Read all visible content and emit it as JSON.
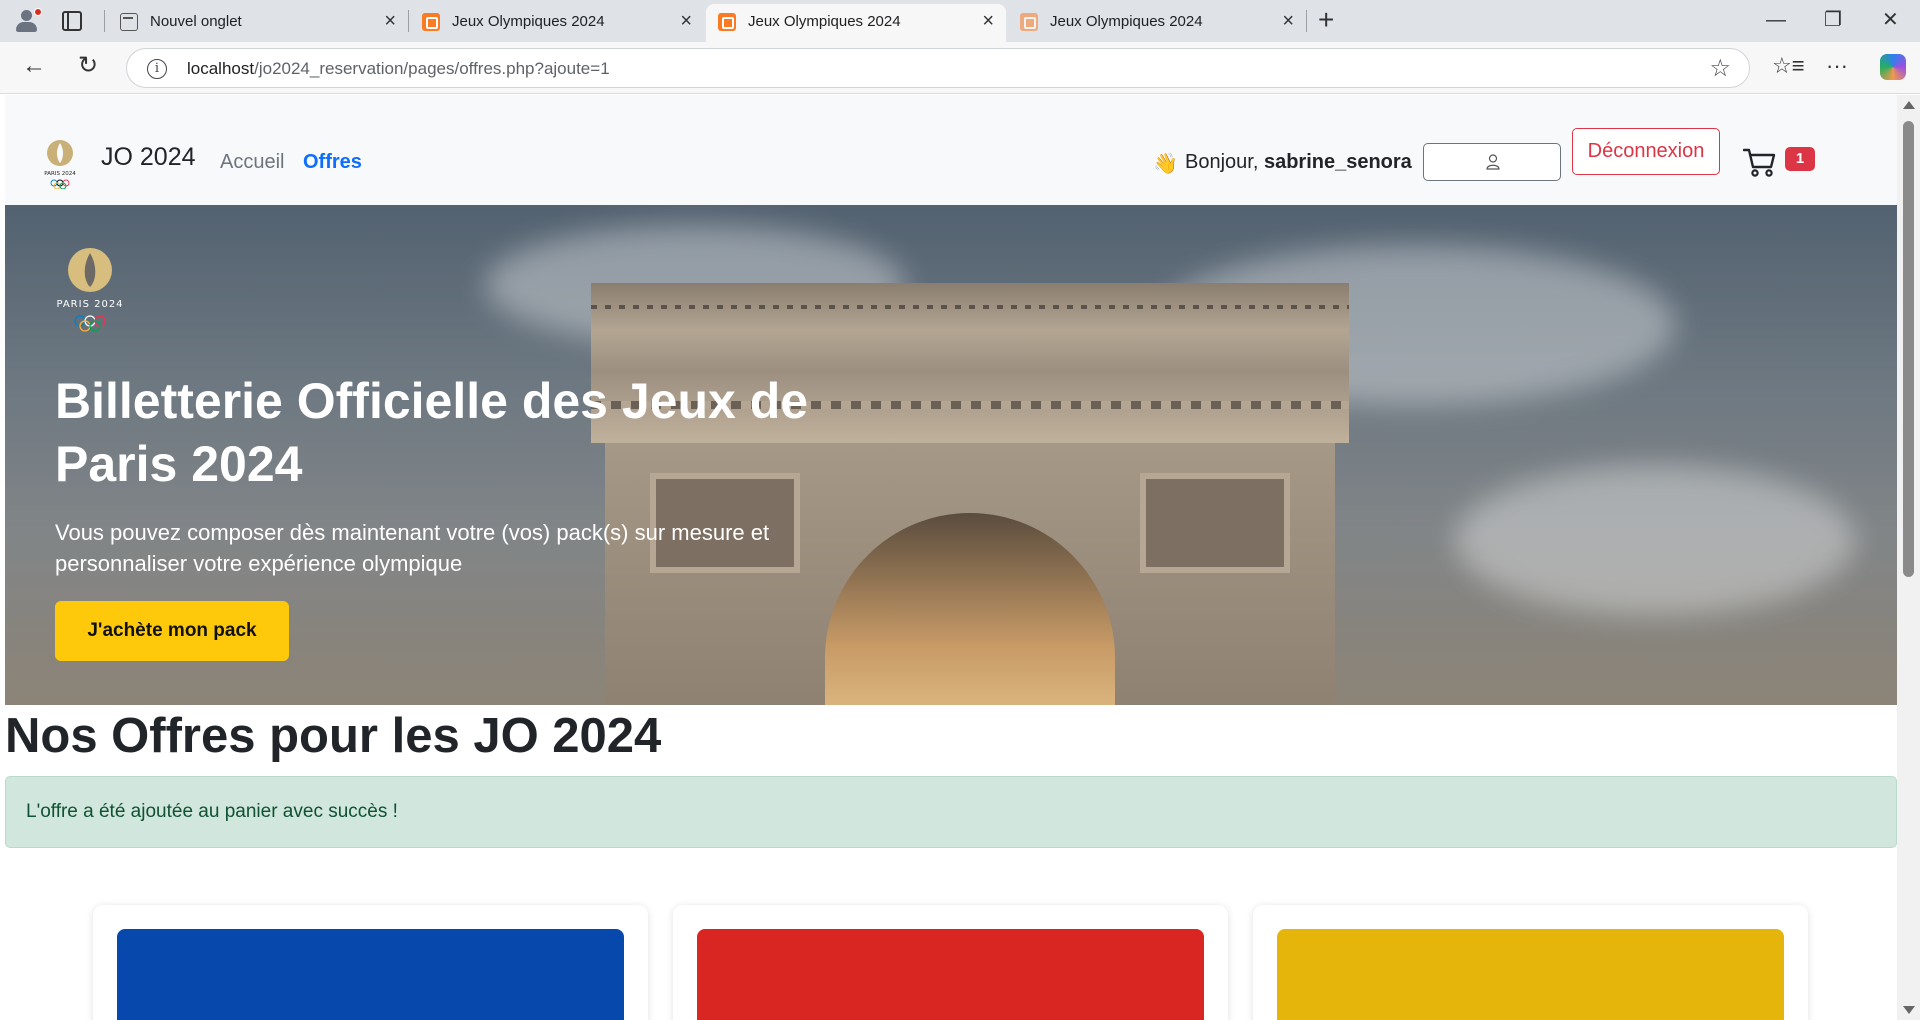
{
  "browser": {
    "tabs": [
      {
        "title": "Nouvel onglet",
        "active": false
      },
      {
        "title": "Jeux Olympiques 2024",
        "active": false
      },
      {
        "title": "Jeux Olympiques 2024",
        "active": true
      },
      {
        "title": "Jeux Olympiques 2024",
        "active": false
      }
    ],
    "url_host": "localhost",
    "url_path": "/jo2024_reservation/pages/offres.php?ajoute=1",
    "icons": {
      "close": "×",
      "new_tab": "+",
      "minimize": "—",
      "restore": "❐",
      "window_close": "✕",
      "back": "←",
      "reload": "↻",
      "info": "i",
      "favorite": "☆",
      "favorites": "☆≡",
      "more": "···"
    }
  },
  "navbar": {
    "brand": "JO 2024",
    "links": [
      {
        "label": "Accueil",
        "active": false
      },
      {
        "label": "Offres",
        "active": true
      }
    ],
    "greeting_icon": "👋",
    "greeting_prefix": "Bonjour, ",
    "username": "sabrine_senora",
    "logout_label": "Déconnexion",
    "cart_count": "1"
  },
  "hero": {
    "logo_text": "PARIS 2024",
    "title": "Billetterie Officielle des Jeux de Paris 2024",
    "subtitle": "Vous pouvez composer dès maintenant votre (vos) pack(s) sur mesure et personnaliser votre expérience olympique",
    "cta_label": "J'achète mon pack"
  },
  "offers": {
    "title": "Nos Offres pour les JO 2024",
    "alert": "L'offre a été ajoutée au panier avec succès !",
    "cards": [
      {
        "color": "#0748ad"
      },
      {
        "color": "#d92622"
      },
      {
        "color": "#e6b50c"
      }
    ]
  },
  "colors": {
    "primary": "#0d6efd",
    "danger": "#dc3545",
    "warning": "#ffc90b",
    "success_bg": "#d1e7dd",
    "success_text": "#0f5132"
  }
}
